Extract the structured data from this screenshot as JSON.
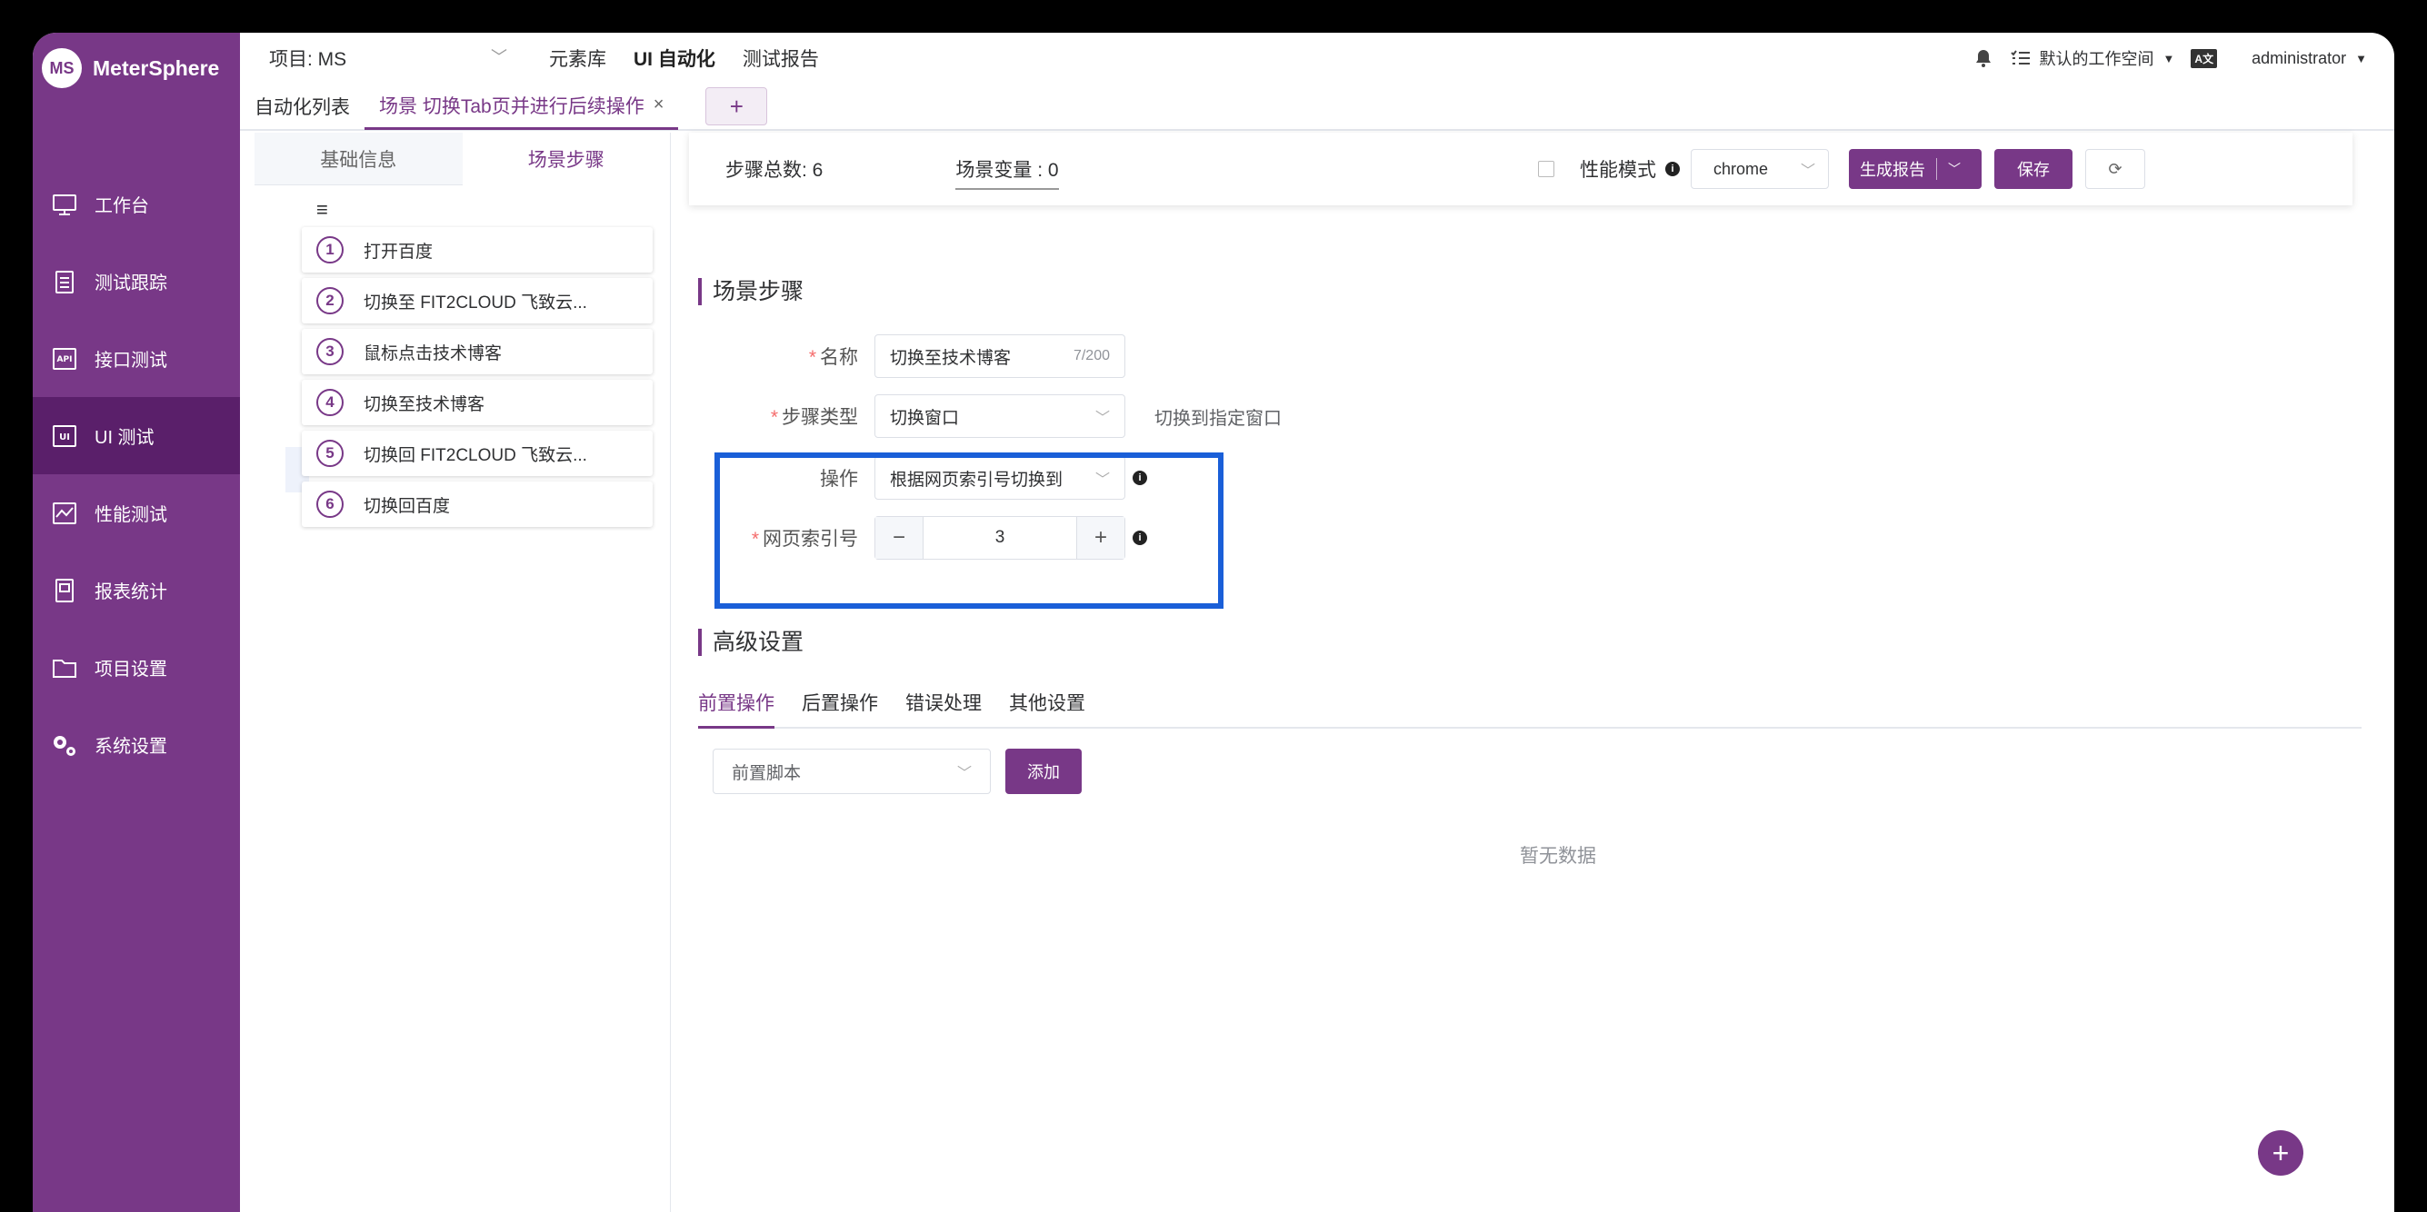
{
  "brand": {
    "logo_mark": "MS",
    "name": "MeterSphere"
  },
  "sidebar": {
    "items": [
      {
        "label": "工作台",
        "icon": "monitor-icon"
      },
      {
        "label": "测试跟踪",
        "icon": "clipboard-icon"
      },
      {
        "label": "接口测试",
        "icon": "api-icon"
      },
      {
        "label": "UI 测试",
        "icon": "ui-icon",
        "active": true
      },
      {
        "label": "性能测试",
        "icon": "chart-icon"
      },
      {
        "label": "报表统计",
        "icon": "report-icon"
      },
      {
        "label": "项目设置",
        "icon": "folder-icon"
      },
      {
        "label": "系统设置",
        "icon": "gears-icon"
      }
    ]
  },
  "topbar": {
    "project": "项目: MS",
    "nav": [
      "元素库",
      "UI 自动化",
      "测试报告"
    ],
    "workspace": "默认的工作空间",
    "lang_badge": "A文",
    "user": "administrator"
  },
  "tabs": {
    "list_tab": "自动化列表",
    "scenario_tab": "场景 切换Tab页并进行后续操作",
    "close": "×",
    "add": "+"
  },
  "left_panel": {
    "tabs": [
      "基础信息",
      "场景步骤"
    ],
    "steps": [
      {
        "num": "1",
        "label": "打开百度"
      },
      {
        "num": "2",
        "label": "切换至 FIT2CLOUD 飞致云..."
      },
      {
        "num": "3",
        "label": "鼠标点击技术博客"
      },
      {
        "num": "4",
        "label": "切换至技术博客"
      },
      {
        "num": "5",
        "label": "切换回 FIT2CLOUD 飞致云..."
      },
      {
        "num": "6",
        "label": "切换回百度"
      }
    ]
  },
  "summary": {
    "total": "步骤总数: 6",
    "vars": "场景变量 : 0",
    "perf_mode": "性能模式",
    "browser": "chrome",
    "report_btn": "生成报告",
    "save_btn": "保存"
  },
  "step_form": {
    "section_title": "场景步骤",
    "name_label": "名称",
    "name_value": "切换至技术博客",
    "name_count": "7/200",
    "type_label": "步骤类型",
    "type_value": "切换窗口",
    "type_hint": "切换到指定窗口",
    "op_label": "操作",
    "op_value": "根据网页索引号切换到",
    "index_label": "网页索引号",
    "index_value": "3"
  },
  "advanced": {
    "section_title": "高级设置",
    "tabs": [
      "前置操作",
      "后置操作",
      "错误处理",
      "其他设置"
    ],
    "pre_select": "前置脚本",
    "add_btn": "添加",
    "empty": "暂无数据"
  },
  "colors": {
    "brand": "#783887",
    "highlight": "#1a5fd8"
  }
}
